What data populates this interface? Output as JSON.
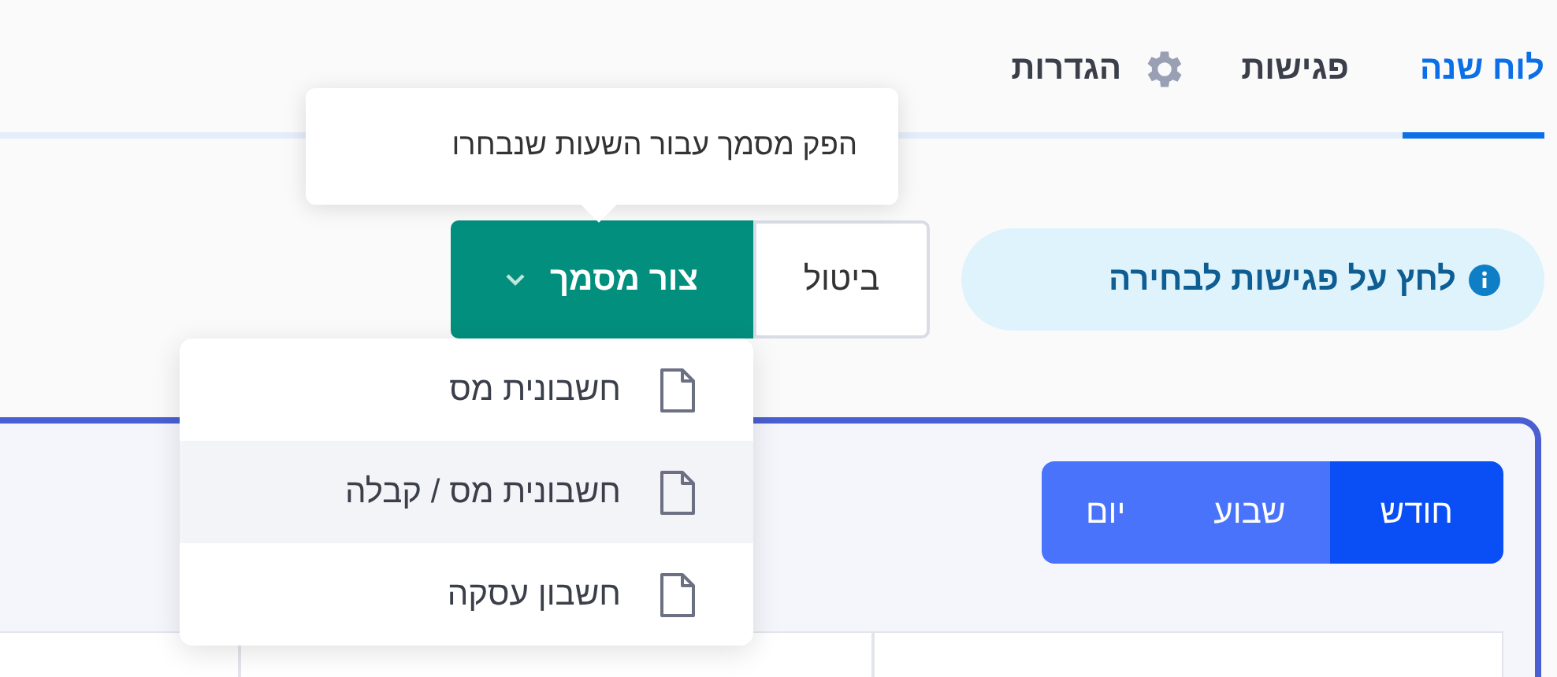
{
  "tabs": [
    {
      "label": "לוח שנה",
      "selected": true,
      "kind": "plain"
    },
    {
      "label": "פגישות",
      "selected": false,
      "kind": "plain"
    },
    {
      "label": "הגדרות",
      "selected": false,
      "kind": "settings"
    }
  ],
  "hint": {
    "text": "לחץ על פגישות לבחירה"
  },
  "buttons": {
    "cancel": "ביטול",
    "create": "צור מסמך"
  },
  "tooltip": {
    "text": "הפק מסמך עבור השעות שנבחרו"
  },
  "menu": [
    {
      "label": "חשבונית מס",
      "highlighted": false
    },
    {
      "label": "חשבונית מס / קבלה",
      "highlighted": true
    },
    {
      "label": "חשבון עסקה",
      "highlighted": false
    }
  ],
  "view_toggle": [
    {
      "label": "חודש",
      "selected": true
    },
    {
      "label": "שבוע",
      "selected": false
    },
    {
      "label": "יום",
      "selected": false
    }
  ]
}
